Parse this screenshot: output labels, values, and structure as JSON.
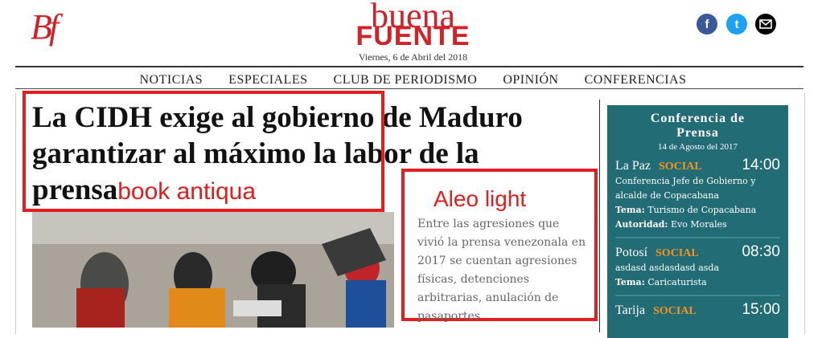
{
  "header": {
    "logo_short": "Bf",
    "brand_top": "buena",
    "brand_bottom": "FUENTE",
    "date": "Viernes, 6 de Abril del 2018"
  },
  "social": {
    "facebook": "f",
    "twitter": "t",
    "mail": "mail-icon"
  },
  "nav": [
    "NOTICIAS",
    "ESPECIALES",
    "CLUB DE PERIODISMO",
    "OPINIÓN",
    "CONFERENCIAS"
  ],
  "article": {
    "headline": "La CIDH exige al gobierno de Maduro garantizar al máximo la labor de la prensa",
    "font_annotation": "book antiqua",
    "teaser_annotation": "Aleo light",
    "teaser": "Entre las agresiones que vivió la prensa venezonala en 2017 se cuentan agresiones físicas, detenciones arbitrarias, anulación de pasaportes"
  },
  "sidebar": {
    "title_line1": "Conferencia de",
    "title_line2": "Prensa",
    "date": "14 de Agosto del 2017",
    "events": [
      {
        "city": "La Paz",
        "tag": "SOCIAL",
        "time": "14:00",
        "desc": "Conferencia Jefe de Gobierno y alcalde de Copacabana",
        "tema_label": "Tema:",
        "tema": "Turismo de Copacabana",
        "autoridad_label": "Autoridad:",
        "autoridad": "Evo Morales"
      },
      {
        "city": "Potosí",
        "tag": "SOCIAL",
        "time": "08:30",
        "desc": "asdasd asdasdasd asda",
        "tema_label": "Tema:",
        "tema": "Caricaturista"
      },
      {
        "city": "Tarija",
        "tag": "SOCIAL",
        "time": "15:00"
      }
    ]
  },
  "colors": {
    "brand_red": "#d42027",
    "annotation_red": "#e41e1e",
    "sidebar_teal": "#226c75",
    "tag_orange": "#f7941d"
  }
}
